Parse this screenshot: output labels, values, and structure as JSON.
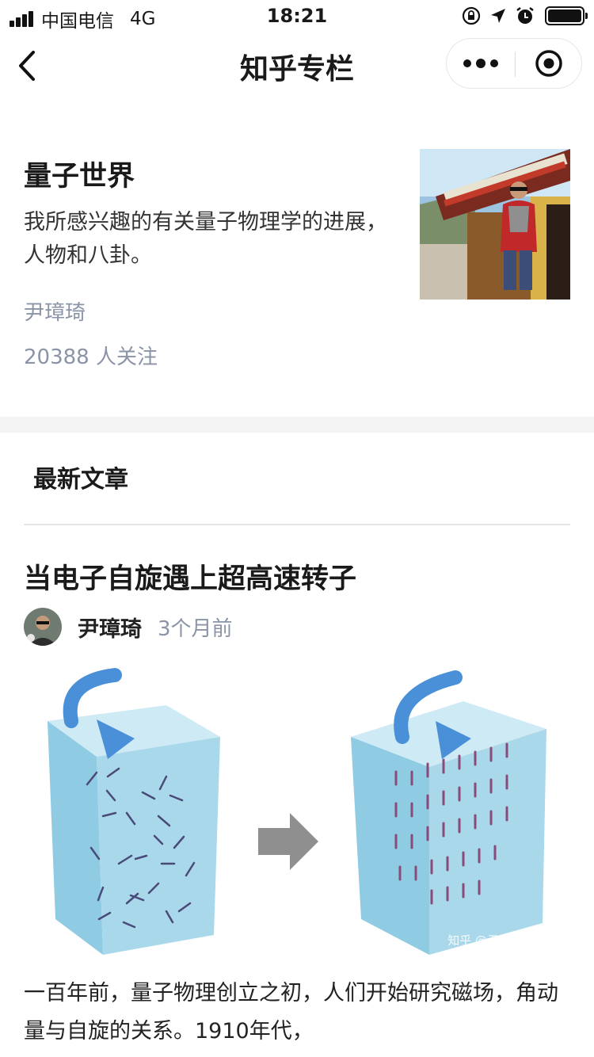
{
  "status_bar": {
    "carrier": "中国电信",
    "network": "4G",
    "time": "18:21"
  },
  "nav": {
    "title": "知乎专栏",
    "back_icon": "chevron-left-icon",
    "more_icon": "more-dots-icon",
    "close_icon": "target-close-icon"
  },
  "column": {
    "title": "量子世界",
    "description": "我所感兴趣的有关量子物理学的进展，人物和八卦。",
    "author": "尹璋琦",
    "followers": "20388 人关注"
  },
  "latest": {
    "label": "最新文章"
  },
  "article": {
    "title": "当电子自旋遇上超高速转子",
    "author": "尹璋琦",
    "time": "3个月前",
    "watermark": "知乎 @尹璋琦",
    "excerpt": "一百年前，量子物理创立之初，人们开始研究磁场，角动量与自旋的关系。1910年代，"
  },
  "colors": {
    "muted": "#8a94a6",
    "section_gap": "#f4f4f4",
    "arrow_blue": "#4a90d9",
    "cube_blue": "#a9d8ea"
  }
}
